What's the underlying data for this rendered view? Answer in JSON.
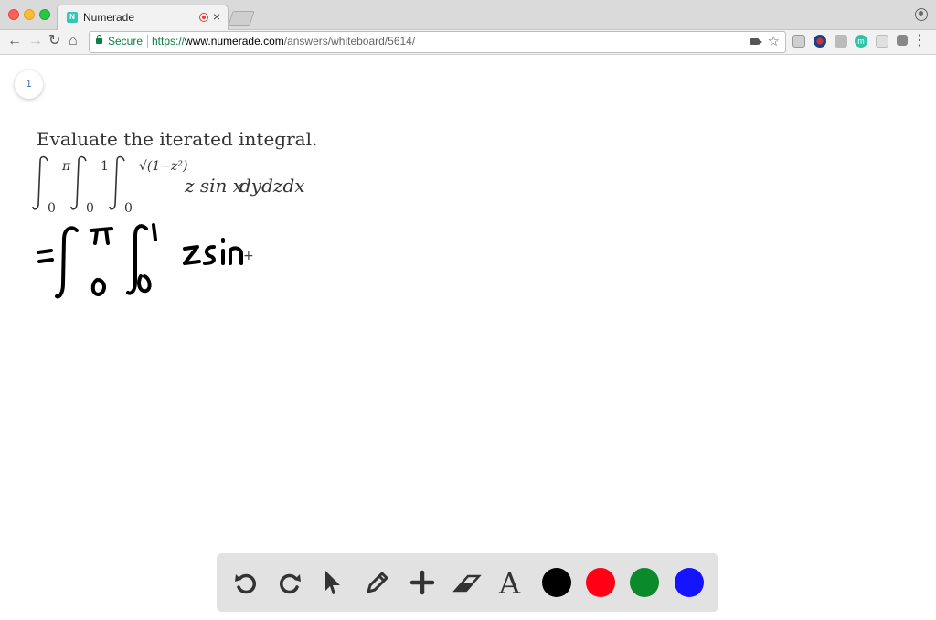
{
  "browser": {
    "tab_title": "Numerade",
    "favicon_letter": "N",
    "security_label": "Secure",
    "url_scheme": "https://",
    "url_host": "www.numerade.com",
    "url_path": "/answers/whiteboard/5614/"
  },
  "page": {
    "page_number": "1",
    "question": "Evaluate the iterated integral.",
    "integral": {
      "limits": [
        {
          "lower": "0",
          "upper": "π"
        },
        {
          "lower": "0",
          "upper": "1"
        },
        {
          "lower": "0",
          "upper": "√(1−z²)"
        }
      ],
      "integrand": "z sin x",
      "differentials": "dydzdx"
    },
    "handwriting": "=∫₀^π ∫₀^1 zsin"
  },
  "tools": {
    "items": [
      "undo-icon",
      "redo-icon",
      "pointer-icon",
      "pencil-icon",
      "plus-icon",
      "eraser-icon",
      "text-icon"
    ],
    "colors": [
      "#000000",
      "#ff0015",
      "#0a8a2a",
      "#1414ff"
    ]
  }
}
